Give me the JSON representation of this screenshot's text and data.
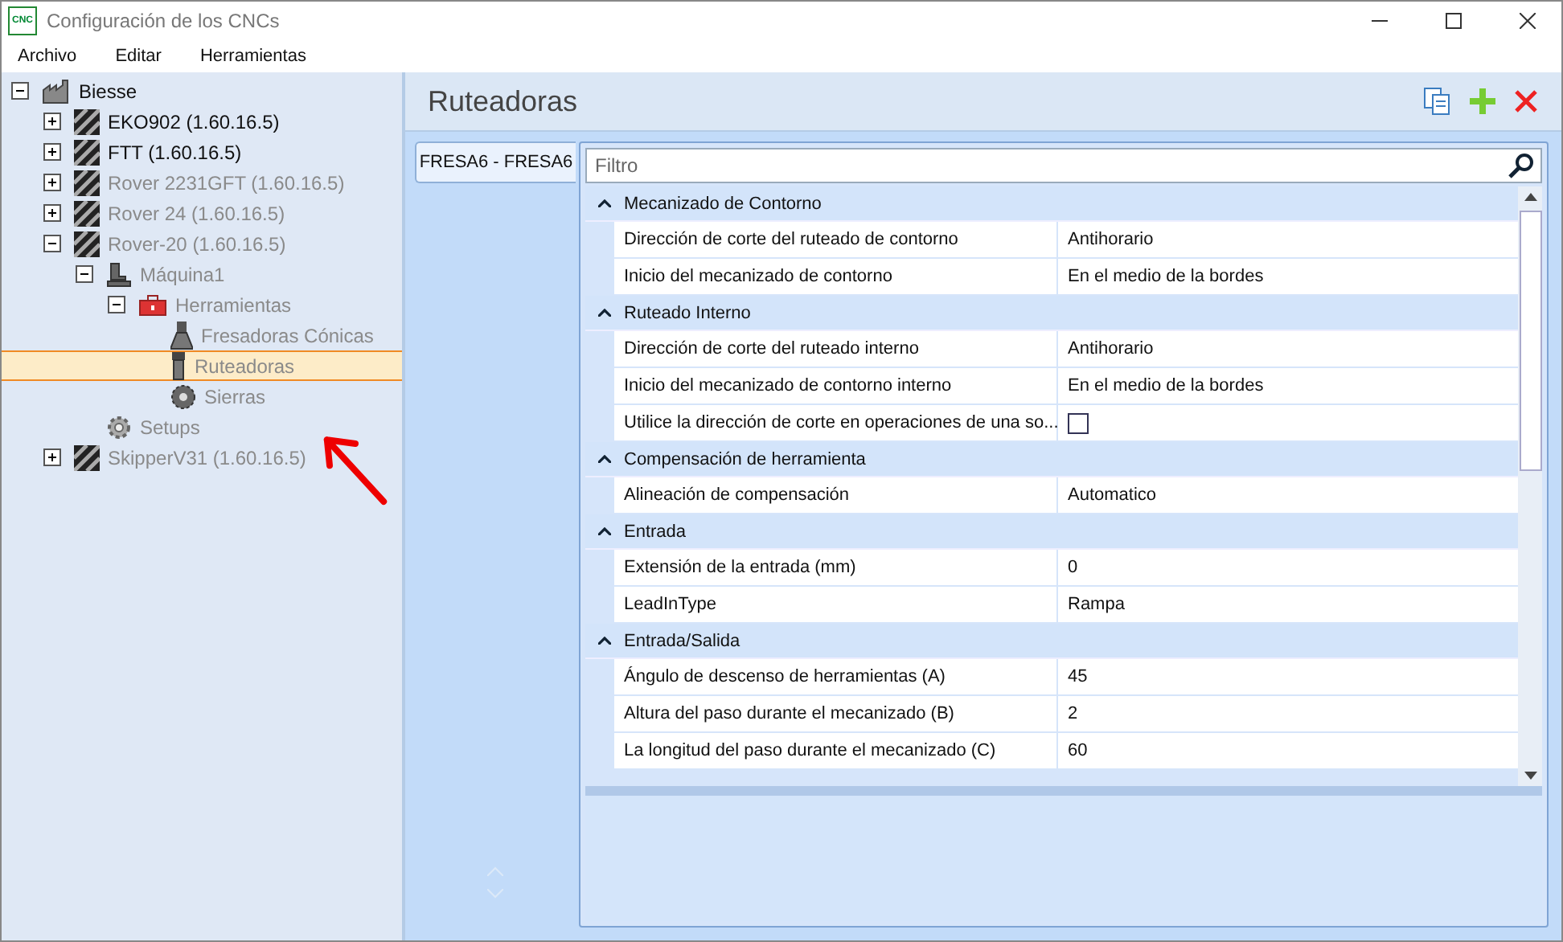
{
  "window": {
    "title": "Configuración de los CNCs",
    "app_icon_label": "CNC"
  },
  "menu": [
    "Archivo",
    "Editar",
    "Herramientas"
  ],
  "tree": [
    {
      "label": "Biesse",
      "kind": "factory",
      "expanded": true,
      "disabled": false,
      "selected": false,
      "children": [
        {
          "label": "EKO902 (1.60.16.5)",
          "kind": "machine",
          "expanded": false,
          "disabled": false,
          "selected": false
        },
        {
          "label": "FTT (1.60.16.5)",
          "kind": "machine",
          "expanded": false,
          "disabled": false,
          "selected": false
        },
        {
          "label": "Rover 2231GFT (1.60.16.5)",
          "kind": "machine",
          "expanded": false,
          "disabled": true,
          "selected": false
        },
        {
          "label": "Rover 24 (1.60.16.5)",
          "kind": "machine",
          "expanded": false,
          "disabled": true,
          "selected": false
        },
        {
          "label": "Rover-20 (1.60.16.5)",
          "kind": "machine",
          "expanded": true,
          "disabled": true,
          "selected": false,
          "children": [
            {
              "label": "Máquina1",
              "kind": "unit",
              "expanded": true,
              "disabled": true,
              "selected": false,
              "children": [
                {
                  "label": "Herramientas",
                  "kind": "toolbox",
                  "expanded": true,
                  "disabled": true,
                  "selected": false,
                  "children": [
                    {
                      "label": "Fresadoras Cónicas",
                      "kind": "conical",
                      "disabled": true,
                      "selected": false
                    },
                    {
                      "label": "Ruteadoras",
                      "kind": "router",
                      "disabled": true,
                      "selected": true
                    },
                    {
                      "label": "Sierras",
                      "kind": "saw",
                      "disabled": true,
                      "selected": false
                    }
                  ]
                }
              ]
            },
            {
              "label": "Setups",
              "kind": "gear",
              "disabled": true,
              "selected": false
            }
          ]
        },
        {
          "label": "SkipperV31 (1.60.16.5)",
          "kind": "machine",
          "expanded": false,
          "disabled": true,
          "selected": false
        }
      ]
    }
  ],
  "panel": {
    "title": "Ruteadoras"
  },
  "tools": [
    {
      "label": "FRESA6 - FRESA6",
      "selected": true
    }
  ],
  "filter": {
    "placeholder": "Filtro"
  },
  "categories": [
    {
      "title": "Mecanizado de Contorno",
      "expanded": true,
      "rows": [
        {
          "kind": "text",
          "name": "Dirección de corte del ruteado de contorno",
          "value": "Antihorario"
        },
        {
          "kind": "text",
          "name": "Inicio del mecanizado de contorno",
          "value": "En el medio de la bordes"
        }
      ]
    },
    {
      "title": "Ruteado Interno",
      "expanded": true,
      "rows": [
        {
          "kind": "text",
          "name": "Dirección de corte del ruteado interno",
          "value": "Antihorario"
        },
        {
          "kind": "text",
          "name": "Inicio del mecanizado de contorno interno",
          "value": "En el medio de la bordes"
        },
        {
          "kind": "checkbox",
          "name": "Utilice la dirección de corte en operaciones de una so...",
          "checked": false
        }
      ]
    },
    {
      "title": "Compensación de herramienta",
      "expanded": true,
      "rows": [
        {
          "kind": "text",
          "name": "Alineación de compensación",
          "value": "Automatico"
        }
      ]
    },
    {
      "title": "Entrada",
      "expanded": true,
      "rows": [
        {
          "kind": "text",
          "name": "Extensión de la entrada (mm)",
          "value": "0"
        },
        {
          "kind": "text",
          "name": "LeadInType",
          "value": "Rampa"
        }
      ]
    },
    {
      "title": "Entrada/Salida",
      "expanded": true,
      "rows": [
        {
          "kind": "text",
          "name": "Ángulo de descenso de herramientas (A)",
          "value": "45"
        },
        {
          "kind": "text",
          "name": "Altura del paso durante el mecanizado (B)",
          "value": "2"
        },
        {
          "kind": "text",
          "name": "La longitud del paso durante el mecanizado (C)",
          "value": "60"
        }
      ]
    }
  ]
}
